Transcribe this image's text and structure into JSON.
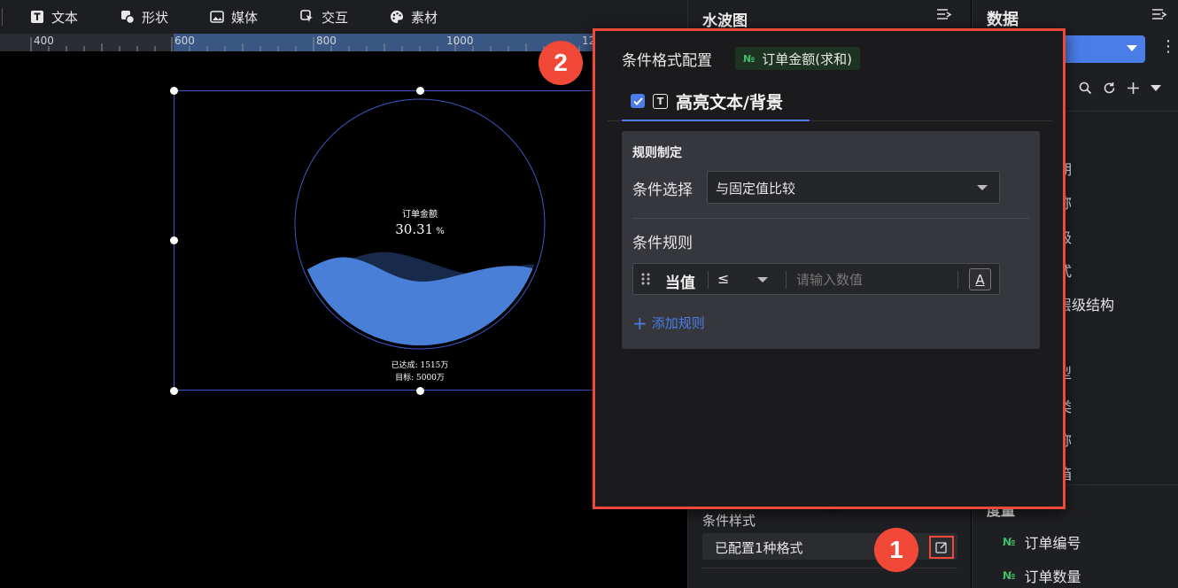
{
  "toolbar": {
    "items": [
      {
        "label": "文本",
        "icon": "text-icon"
      },
      {
        "label": "形状",
        "icon": "shape-icon"
      },
      {
        "label": "媒体",
        "icon": "media-icon"
      },
      {
        "label": "交互",
        "icon": "interact-icon"
      },
      {
        "label": "素材",
        "icon": "palette-icon"
      }
    ]
  },
  "ruler": {
    "labels": [
      "400",
      "600",
      "800",
      "1000",
      "12"
    ]
  },
  "chart_data": {
    "type": "liquid-fill",
    "label": "订单金额",
    "value": 30.31,
    "value_text": "30.31",
    "unit": "%",
    "achieved": "已达成: 1515万",
    "target": "目标: 5000万",
    "wave_color": "#4a7fd8"
  },
  "mid_panel": {
    "title": "水波图",
    "condition_style_label": "条件样式",
    "condition_style_value": "已配置1种格式"
  },
  "right_panel": {
    "title": "数据",
    "fields_visible": [
      "期",
      "称",
      "级",
      "式",
      "层级结构",
      "型",
      "类",
      "称",
      "箱"
    ],
    "measure_head": "度量",
    "measures": [
      {
        "label": "订单编号",
        "badge": "№"
      },
      {
        "label": "订单数量",
        "badge": "№"
      }
    ]
  },
  "popup": {
    "title": "条件格式配置",
    "field_badge": "№",
    "field": "订单金额(求和)",
    "tab_label": "高亮文本/背景",
    "tab_icon": "T",
    "rule_card": {
      "title": "规则制定",
      "condition_label": "条件选择",
      "condition_value": "与固定值比较",
      "rules_label": "条件规则",
      "row": {
        "value_label": "当值",
        "operator": "≤",
        "placeholder": "请输入数值",
        "style_button": "A"
      },
      "add_rule": "添加规则"
    }
  },
  "callouts": [
    "1",
    "2"
  ],
  "colors": {
    "accent": "#4a7de8",
    "highlight": "#f24838",
    "selection": "#3e58c8"
  }
}
